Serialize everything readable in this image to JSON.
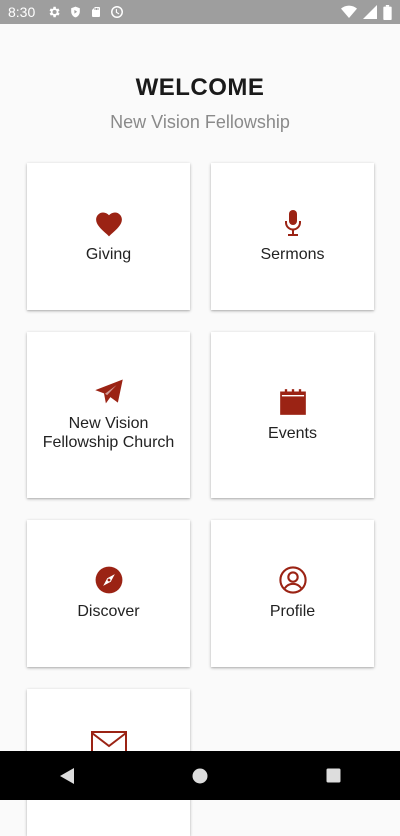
{
  "status_bar": {
    "time": "8:30",
    "icons": [
      "gear-icon",
      "shield-play-icon",
      "sd-card-icon",
      "sync-icon",
      "wifi-icon",
      "signal-icon",
      "battery-icon"
    ]
  },
  "header": {
    "title": "WELCOME",
    "subtitle": "New Vision Fellowship"
  },
  "accent_color": "#9b2314",
  "tiles": [
    {
      "label": "Giving",
      "icon": "heart-icon"
    },
    {
      "label": "Sermons",
      "icon": "microphone-icon"
    },
    {
      "label": "New Vision Fellowship Church",
      "icon": "paper-plane-icon"
    },
    {
      "label": "Events",
      "icon": "calendar-icon"
    },
    {
      "label": "Discover",
      "icon": "compass-icon"
    },
    {
      "label": "Profile",
      "icon": "user-circle-icon"
    },
    {
      "label": "",
      "icon": "envelope-icon"
    }
  ],
  "nav_bar": {
    "buttons": [
      "back-icon",
      "home-icon",
      "recents-icon"
    ]
  }
}
